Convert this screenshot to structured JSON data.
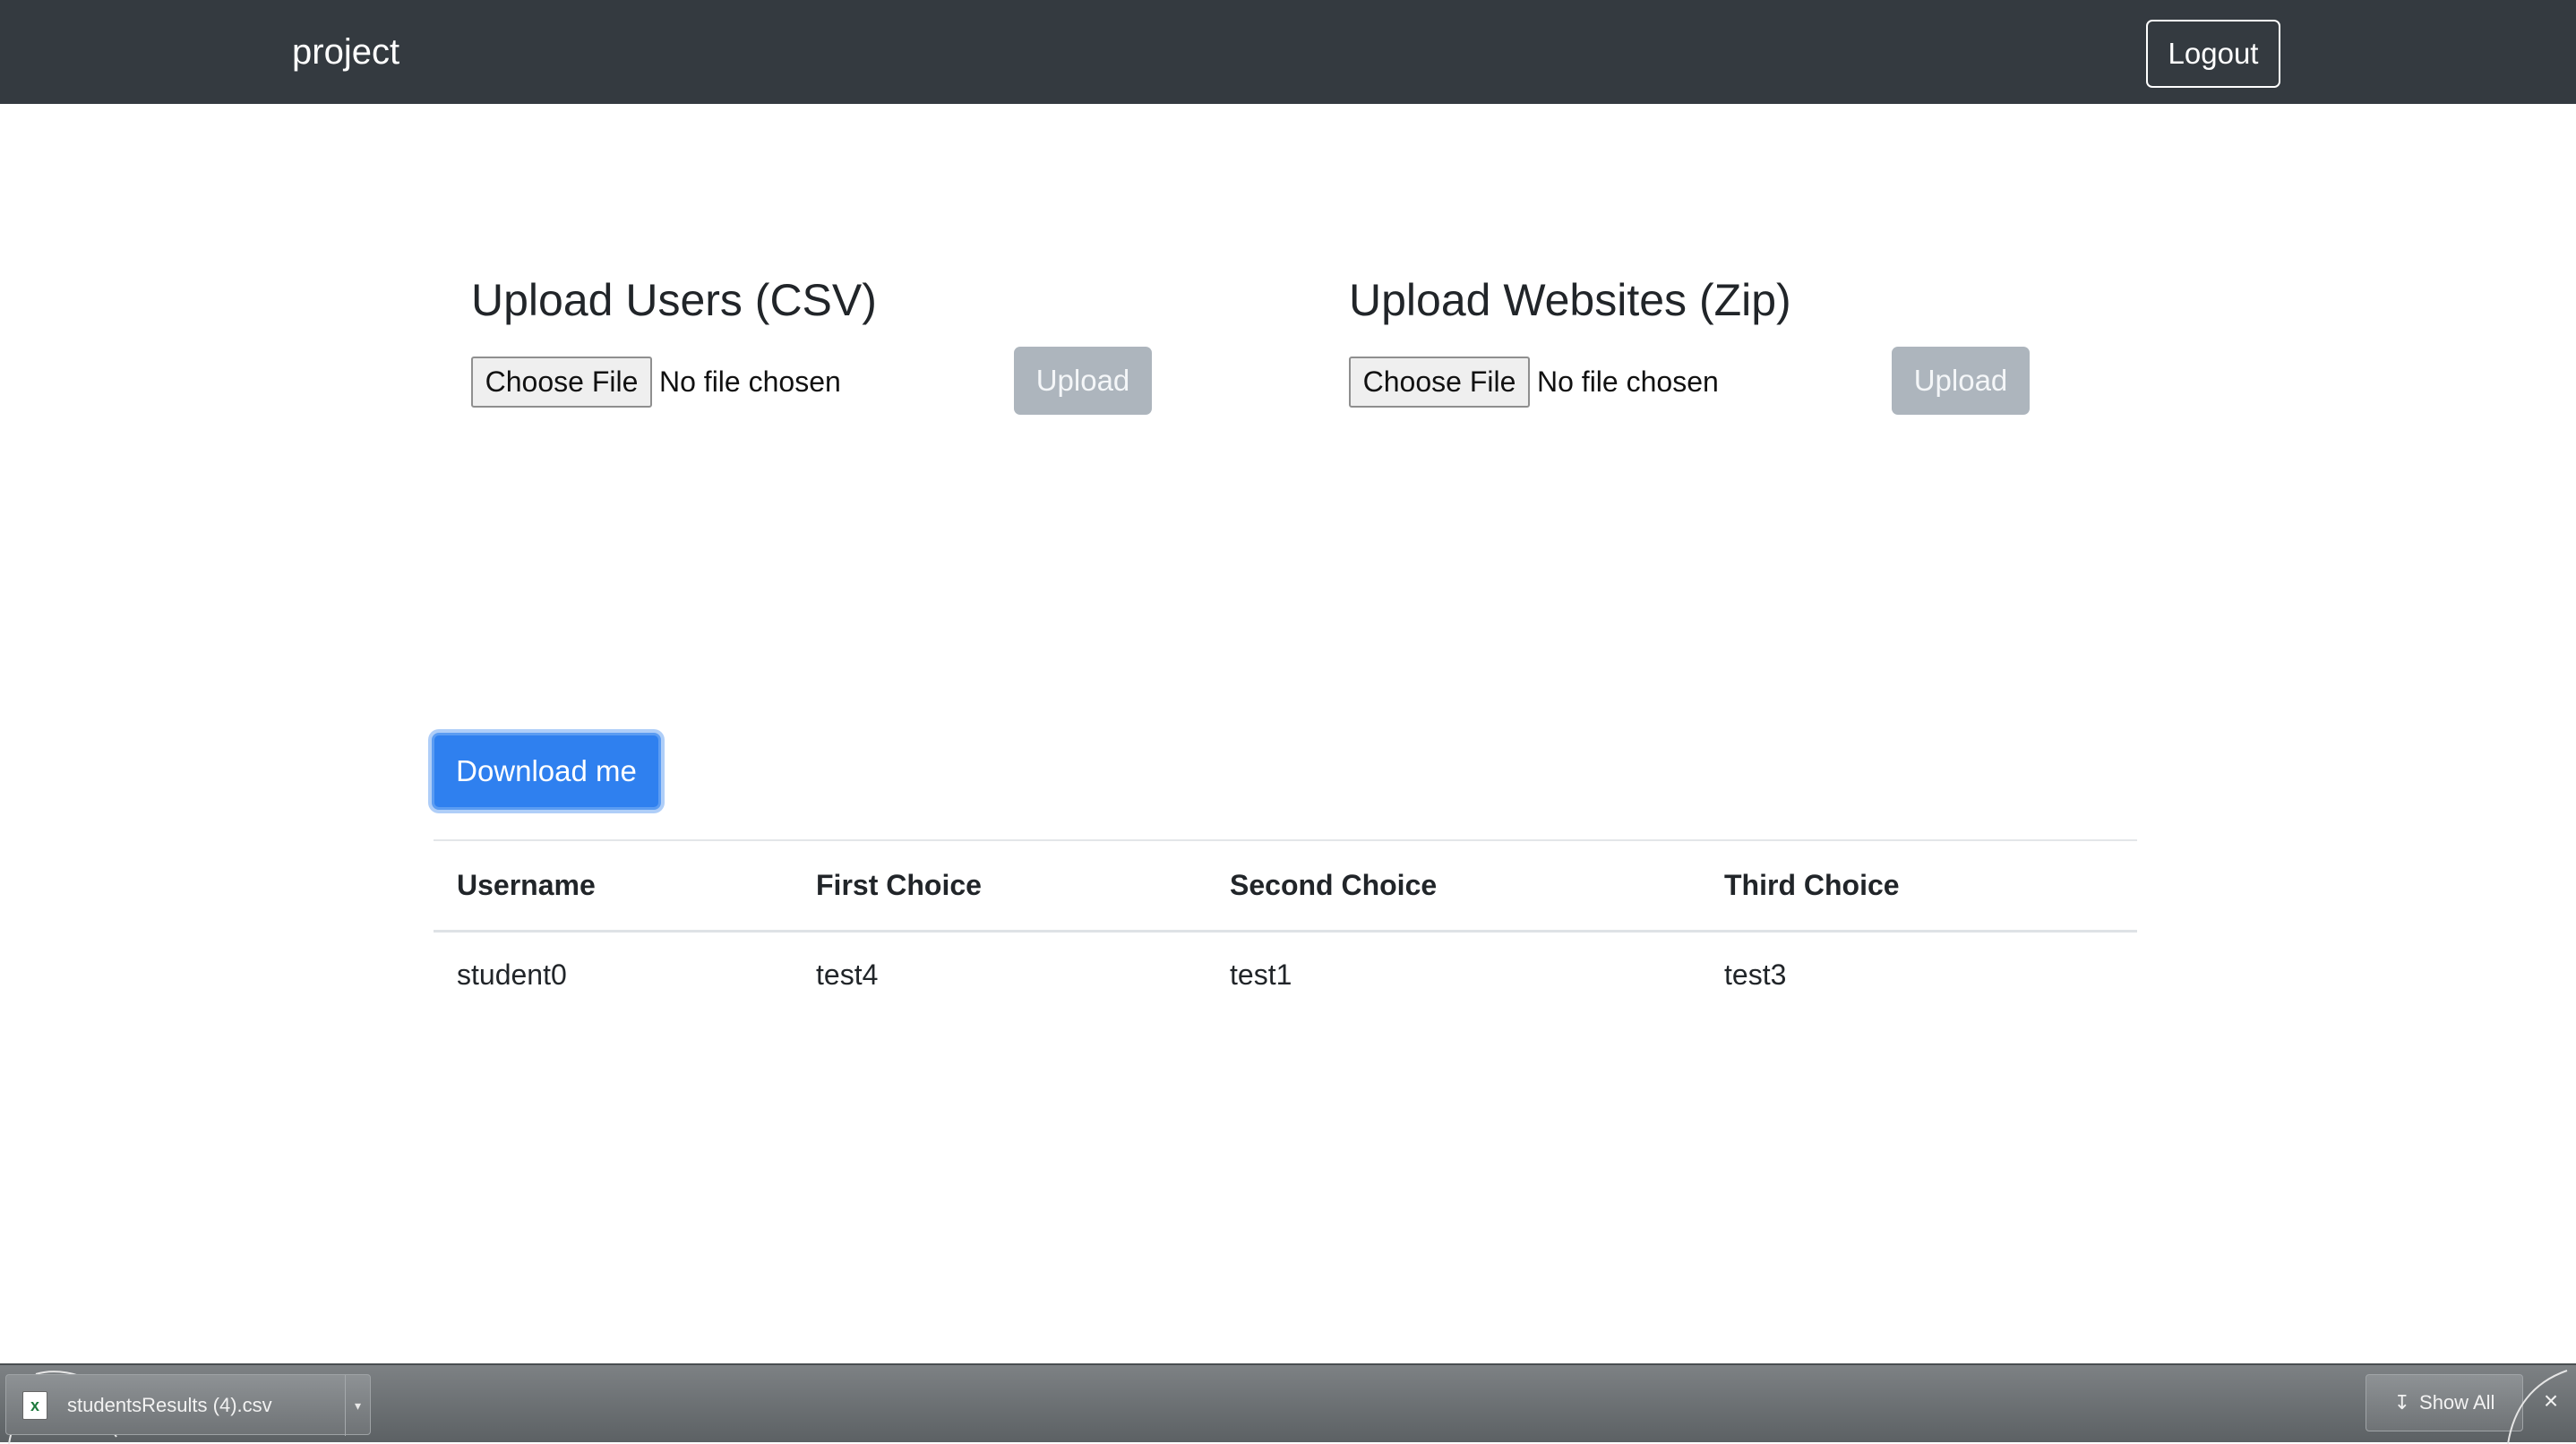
{
  "navbar": {
    "brand": "project",
    "logout_label": "Logout"
  },
  "uploads": [
    {
      "title": "Upload Users (CSV)",
      "choose_label": "Choose File",
      "file_status": "No file chosen",
      "upload_label": "Upload"
    },
    {
      "title": "Upload Websites (Zip)",
      "choose_label": "Choose File",
      "file_status": "No file chosen",
      "upload_label": "Upload"
    }
  ],
  "download": {
    "label": "Download me"
  },
  "table": {
    "headers": [
      "Username",
      "First Choice",
      "Second Choice",
      "Third Choice"
    ],
    "rows": [
      [
        "student0",
        "test4",
        "test1",
        "test3"
      ]
    ]
  },
  "download_bar": {
    "file_name": "studentsResults (4).csv",
    "show_all_label": "Show All",
    "file_icon": "excel-file-icon",
    "close_icon": "close-icon"
  },
  "colors": {
    "navbar_bg": "#343a40",
    "primary": "#2f80ef",
    "disabled_upload": "#adb5bd"
  }
}
